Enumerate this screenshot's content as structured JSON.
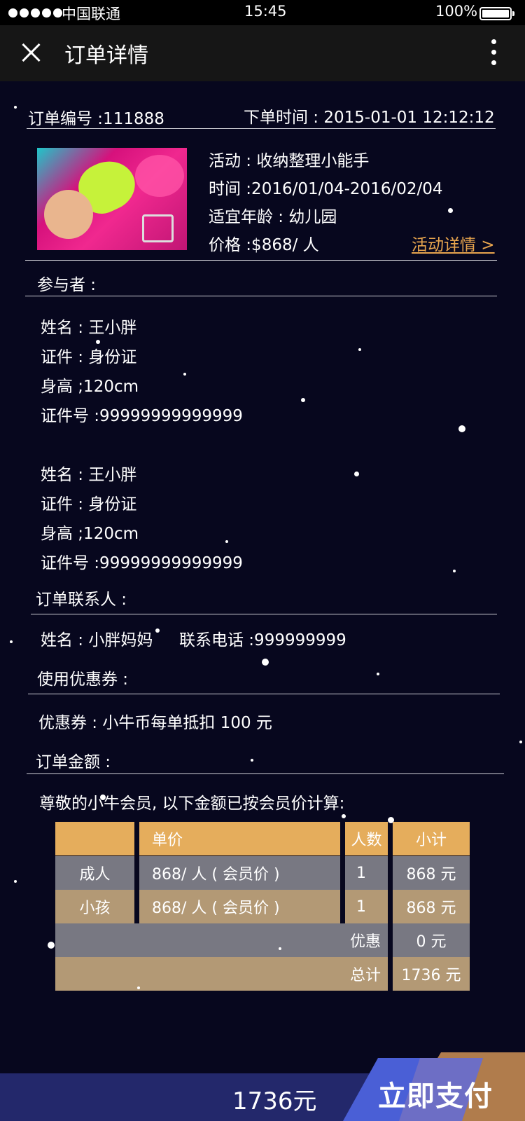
{
  "status_bar": {
    "carrier": "中国联通",
    "time": "15:45",
    "battery": "100%"
  },
  "header": {
    "title": "订单详情"
  },
  "order": {
    "number": "订单编号 :111888",
    "time": "下单时间 : 2015-01-01  12:12:12"
  },
  "activity": {
    "name": "活动 : 收纳整理小能手",
    "period": "时间 :2016/01/04-2016/02/04",
    "age": "适宜年龄 : 幼儿园",
    "price": "价格 :$868/ 人",
    "detail_link": "活动详情 >"
  },
  "participants": {
    "label": "参与者 :",
    "items": [
      {
        "name": "姓名 : 王小胖",
        "id_type": "证件 : 身份证",
        "height": "身高 ;120cm",
        "id_number": "证件号 :99999999999999"
      },
      {
        "name": "姓名 : 王小胖",
        "id_type": "证件 : 身份证",
        "height": "身高 ;120cm",
        "id_number": "证件号 :99999999999999"
      }
    ]
  },
  "contact": {
    "label": "订单联系人 :",
    "name": "姓名 : 小胖妈妈",
    "phone": "联系电话 :999999999"
  },
  "coupon": {
    "label": "使用优惠券 :",
    "value": "优惠券 : 小牛币每单抵扣 100 元"
  },
  "amount": {
    "label": "订单金额 :",
    "note": "尊敬的小牛会员, 以下金额已按会员价计算:",
    "table": {
      "headers": [
        "",
        "单价",
        "人数",
        "小计"
      ],
      "rows": [
        [
          "成人",
          "868/ 人 ( 会员价 )",
          "1",
          "868 元"
        ],
        [
          "小孩",
          "868/ 人 ( 会员价 )",
          "1",
          "868 元"
        ]
      ],
      "discount_label": "优惠",
      "discount_value": "0 元",
      "total_label": "总计",
      "total_value": "1736 元"
    }
  },
  "footer": {
    "total": "1736元",
    "pay_button": "立即支付"
  },
  "colors": {
    "background": "#07071e",
    "accent_gold": "#e5ad5c",
    "link": "#e8a54e",
    "footer": "#23286b",
    "pay_button": "#4a5fd6"
  }
}
